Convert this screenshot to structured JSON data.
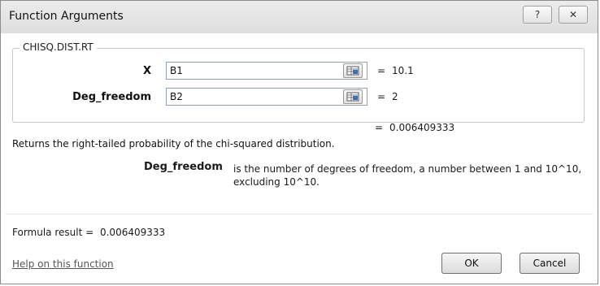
{
  "window": {
    "title": "Function Arguments",
    "help_btn": "?",
    "close_btn": "✕"
  },
  "function": {
    "name": "CHISQ.DIST.RT"
  },
  "arguments": [
    {
      "label": "X",
      "input": "B1",
      "equals": "=",
      "value": "10.1"
    },
    {
      "label": "Deg_freedom",
      "input": "B2",
      "equals": "=",
      "value": "2"
    }
  ],
  "result": {
    "equals": "=",
    "value": "0.006409333"
  },
  "description": "Returns the right-tailed probability of the chi-squared distribution.",
  "arg_help": {
    "name": "Deg_freedom",
    "text": "is the number of degrees of freedom, a number between 1 and 10^10, excluding 10^10."
  },
  "formula": {
    "label": "Formula result =",
    "value": "0.006409333"
  },
  "footer": {
    "help_link": "Help on this function",
    "ok": "OK",
    "cancel": "Cancel"
  }
}
